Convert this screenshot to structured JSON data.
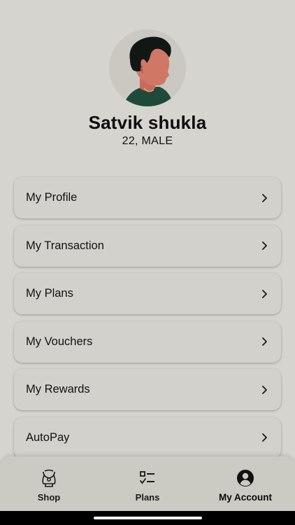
{
  "profile": {
    "name": "Satvik shukla",
    "details": "22, MALE"
  },
  "menu": {
    "items": [
      {
        "label": "My Profile"
      },
      {
        "label": "My Transaction"
      },
      {
        "label": "My Plans"
      },
      {
        "label": "My Vouchers"
      },
      {
        "label": "My Rewards"
      },
      {
        "label": "AutoPay"
      }
    ]
  },
  "bottom_nav": {
    "items": [
      {
        "label": "Shop",
        "icon": "jewelry-bust-icon"
      },
      {
        "label": "Plans",
        "icon": "checklist-icon"
      },
      {
        "label": "My Account",
        "icon": "account-circle-icon",
        "active": true
      }
    ]
  },
  "colors": {
    "background": "#d5d4ce",
    "card": "#d2d1cc",
    "nav_background": "#cbcac3"
  }
}
